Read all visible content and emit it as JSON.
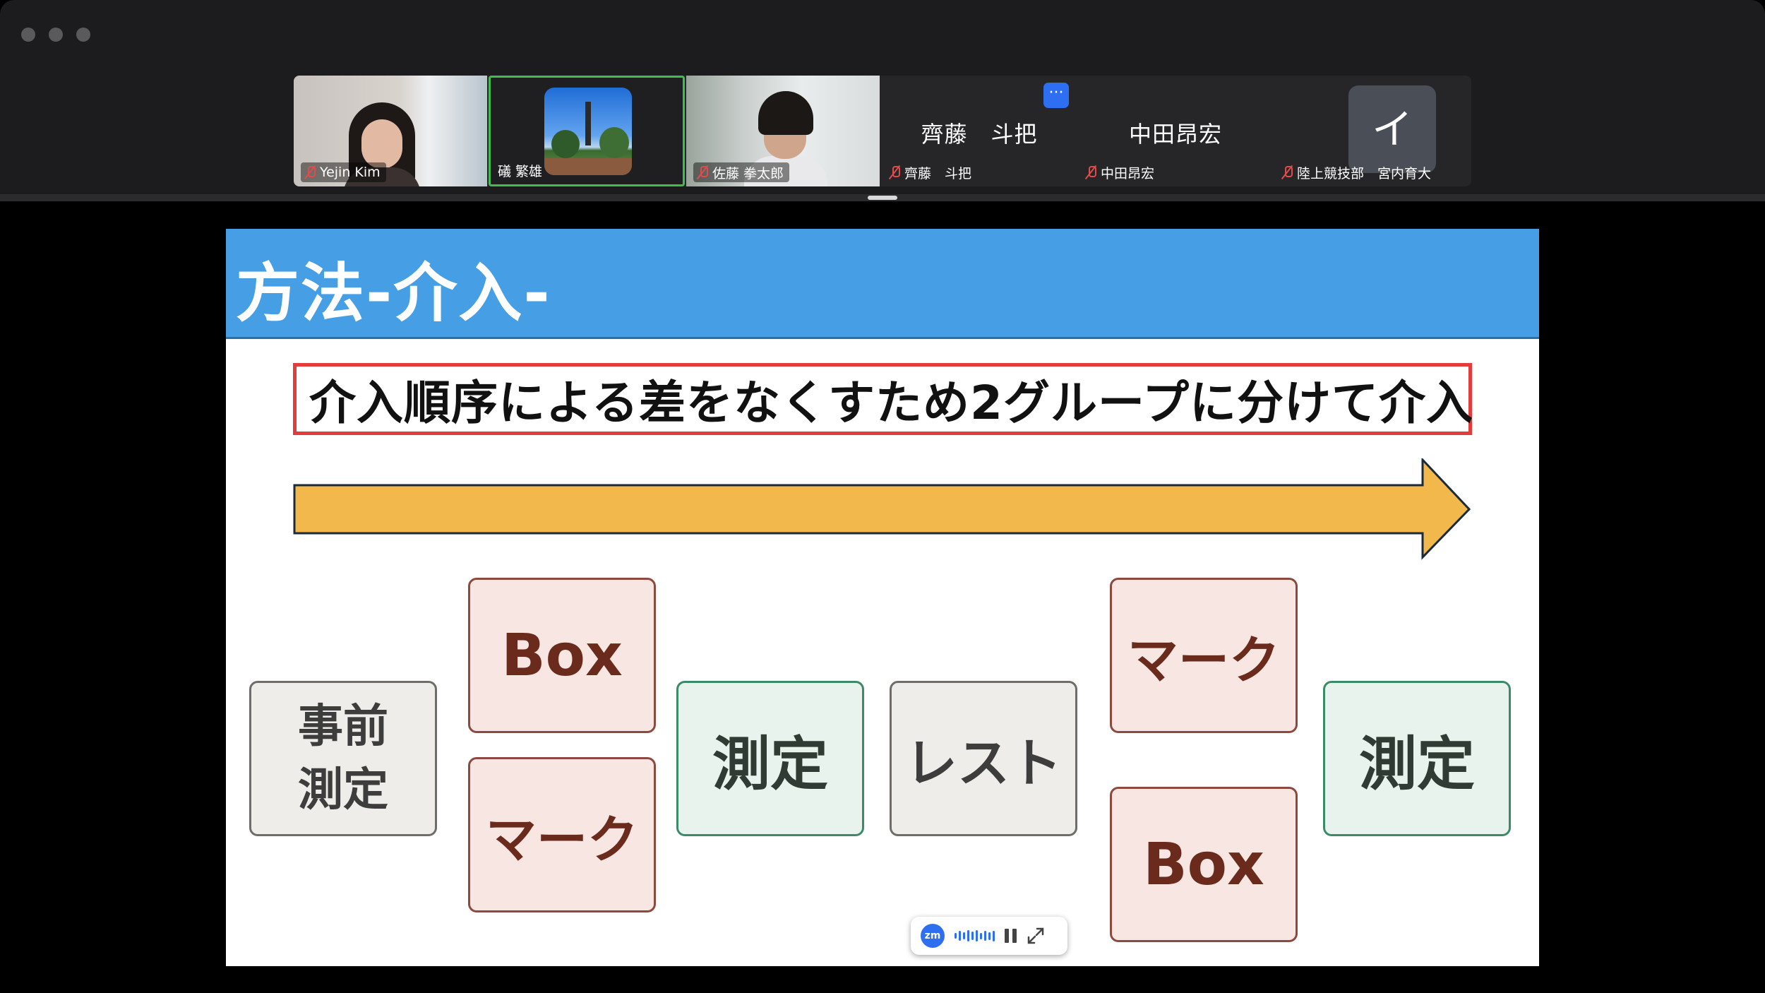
{
  "participants": [
    {
      "name": "Yejin Kim",
      "muted": true
    },
    {
      "name": "礒 繁雄",
      "muted": false,
      "active_speaker": true
    },
    {
      "name": "佐藤 拳太郎",
      "muted": true
    },
    {
      "display_name": "齊藤　斗把",
      "name": "齊藤　斗把",
      "muted": true
    },
    {
      "display_name": "中田昂宏",
      "name": "中田昂宏",
      "muted": true
    },
    {
      "avatar_initial": "イ",
      "name": "陸上競技部　宮内育大",
      "muted": true
    }
  ],
  "more_button": "···",
  "slide": {
    "title": "方法-介入-",
    "banner": "介入順序による差をなくすため2グループに分けて介入",
    "arrow_color": "#f2b84b",
    "boxes": {
      "pre_line1": "事前",
      "pre_line2": "測定",
      "box_top": "Box",
      "mark_bottom": "マーク",
      "measure_mid": "測定",
      "rest": "レスト",
      "mark_top": "マーク",
      "box_bottom": "Box",
      "measure_end": "測定"
    }
  },
  "zoom_bar": {
    "logo": "zm"
  },
  "colors": {
    "header": "#469fe4",
    "banner_border": "#e23d3b",
    "active_speaker": "#3fbd4e",
    "zoom_blue": "#2d6ff0"
  }
}
